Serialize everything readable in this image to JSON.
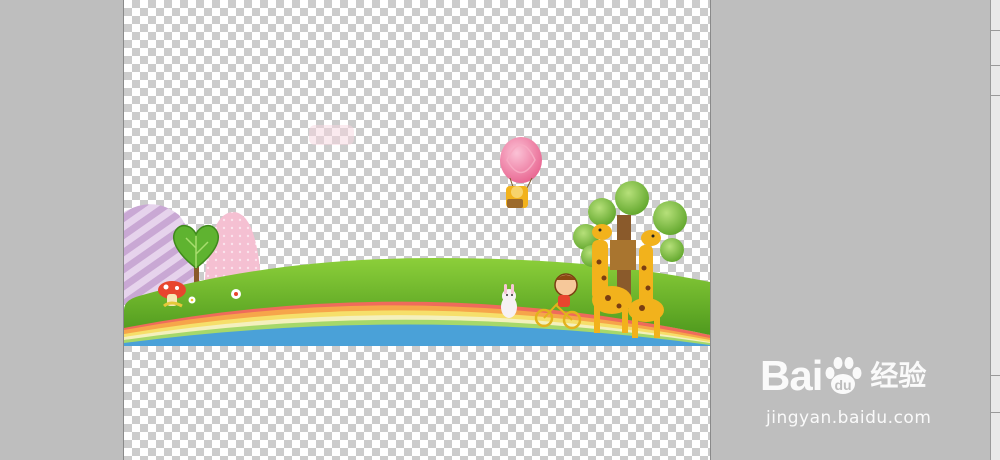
{
  "watermark": {
    "brand_left": "Bai",
    "brand_right": "du",
    "brand_cn": "经验",
    "url": "jingyan.baidu.com"
  },
  "icons": {
    "paw": "baidu-paw-icon"
  },
  "colors": {
    "workspace": "#bebebe",
    "checker_light": "#ffffff",
    "checker_dark": "#cccccc",
    "grass": "#6bb52a",
    "giraffe": "#f2b21c",
    "balloon": "#ef7aa3"
  }
}
